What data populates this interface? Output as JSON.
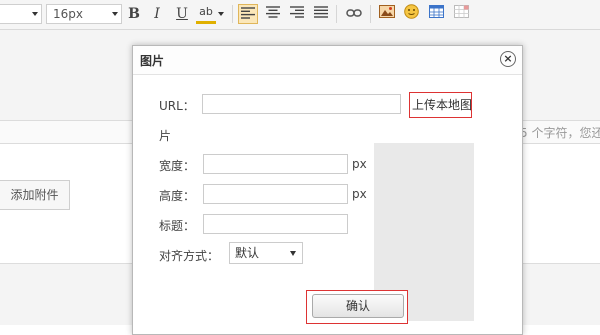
{
  "toolbar": {
    "font_size_value": "16px",
    "buttons": {
      "bold": "B",
      "italic": "I",
      "underline": "U",
      "highlight": "ab"
    },
    "icons": [
      "align-left-icon",
      "align-center-icon",
      "align-right-icon",
      "align-justify-icon",
      "link-icon",
      "image-icon",
      "emoji-icon",
      "table-icon",
      "grid-icon"
    ]
  },
  "editor": {
    "char_count_text": "5 个字符，您还",
    "attach_label": "添加附件"
  },
  "dialog": {
    "title": "图片",
    "close_symbol": "×",
    "url_label": "URL：",
    "url_value": "",
    "upload_label": "上传本地图",
    "upload_wrap": "片",
    "width_label": "宽度：",
    "width_unit": "px",
    "height_label": "高度：",
    "height_unit": "px",
    "title_label": "标题：",
    "align_label": "对齐方式：",
    "align_value": "默认",
    "confirm_label": "确认"
  },
  "colors": {
    "accent_border": "#dd3333",
    "active_button_bg": "#fbe7b9"
  }
}
